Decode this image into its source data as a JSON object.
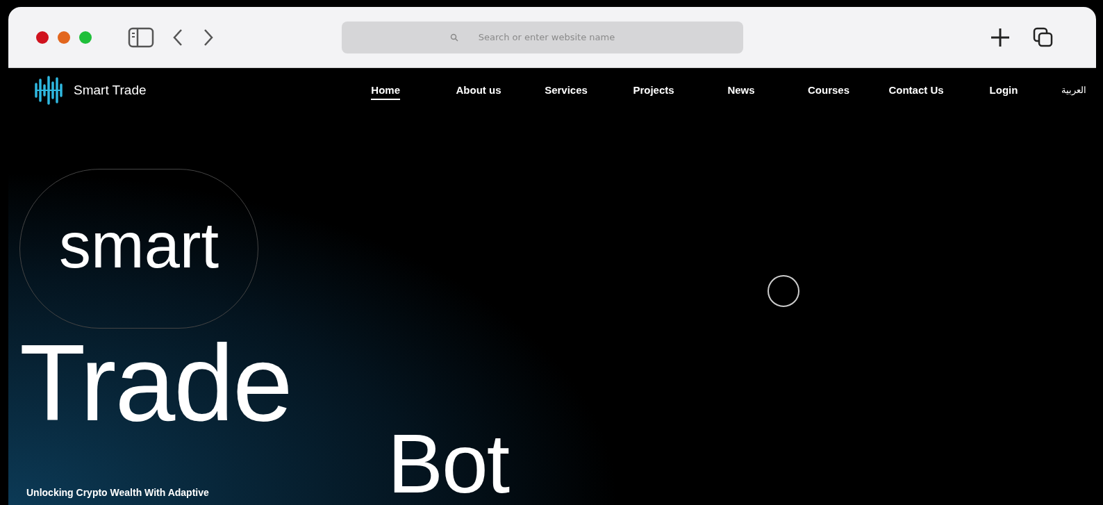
{
  "browser": {
    "address_placeholder": "Search or enter website name"
  },
  "site": {
    "brand": "Smart Trade",
    "nav": [
      {
        "label": "Home",
        "selected": true
      },
      {
        "label": "About us",
        "selected": false
      },
      {
        "label": "Services",
        "selected": false
      },
      {
        "label": "Projects",
        "selected": false
      },
      {
        "label": "News",
        "selected": false
      },
      {
        "label": "Courses",
        "selected": false
      },
      {
        "label": "Contact Us",
        "selected": false
      },
      {
        "label": "Login",
        "selected": false
      }
    ],
    "language": "العربية"
  },
  "hero": {
    "pill_word": "smart",
    "word": "Trade",
    "word_right": "Bot",
    "subtitle": "Unlocking Crypto Wealth With Adaptive"
  }
}
